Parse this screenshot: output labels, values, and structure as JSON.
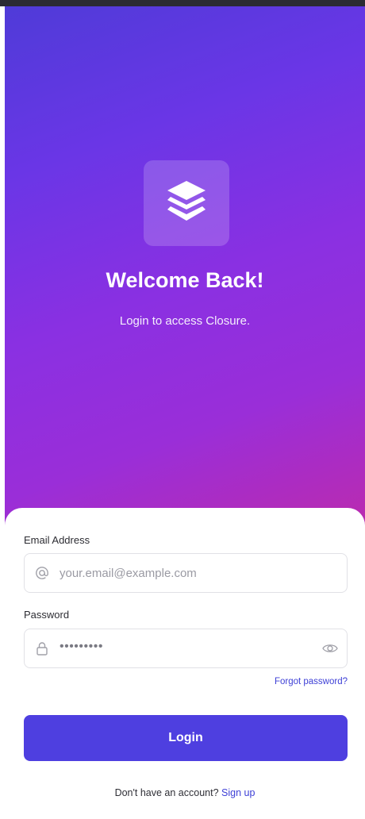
{
  "hero": {
    "logo_icon": "layers-icon",
    "title": "Welcome Back!",
    "subtitle": "Login to access Closure."
  },
  "form": {
    "email": {
      "label": "Email Address",
      "icon": "at-icon",
      "placeholder": "your.email@example.com"
    },
    "password": {
      "label": "Password",
      "icon": "lock-icon",
      "value": "•••••••••",
      "toggle_icon": "eye-icon"
    },
    "forgot_link": "Forgot password?",
    "login_button": "Login",
    "signup_prompt": "Don't have an account?",
    "signup_link": "Sign up"
  },
  "colors": {
    "gradient_start": "#4f3bd8",
    "gradient_mid": "#8a30e2",
    "gradient_end": "#c22aa6",
    "primary": "#4e3fe0",
    "link": "#3d3fd6"
  }
}
